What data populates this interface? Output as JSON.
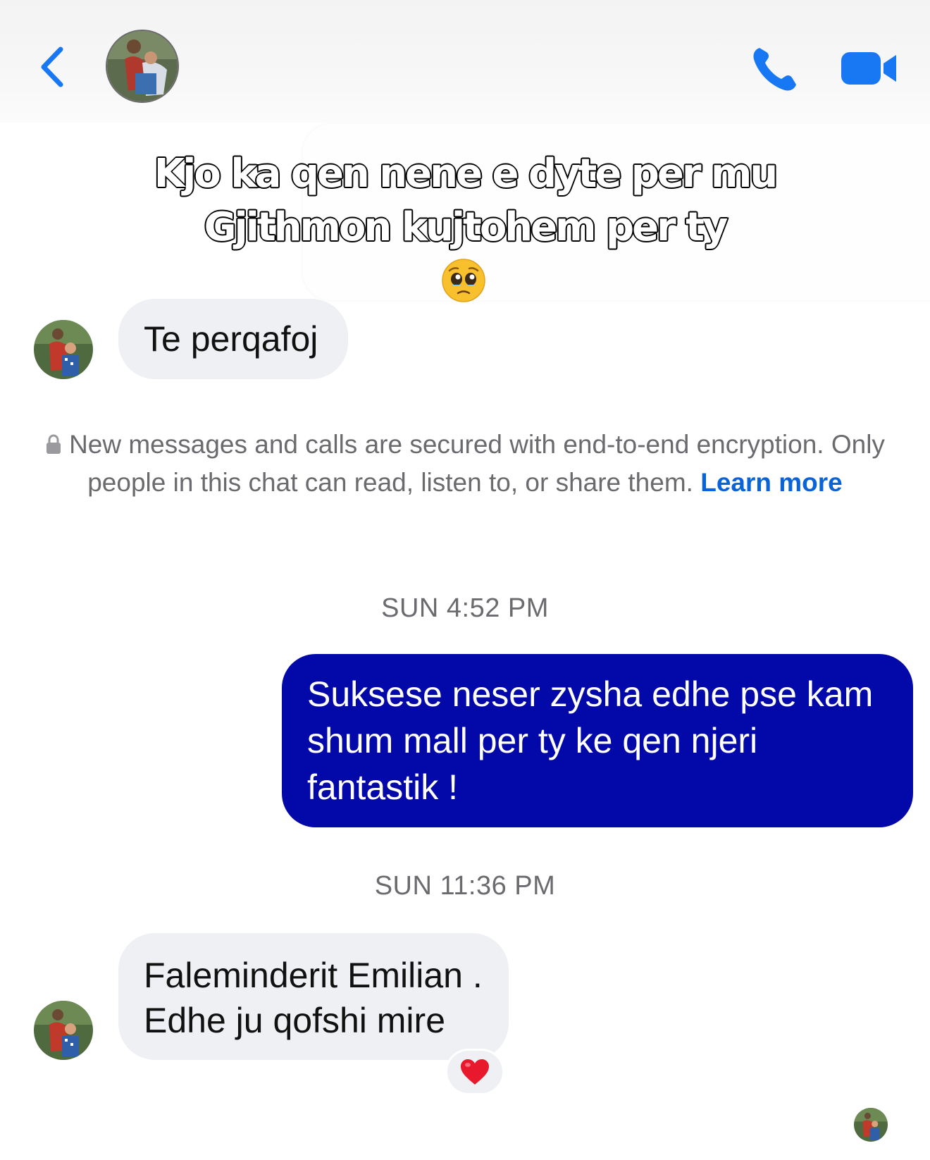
{
  "header": {
    "back_icon": "chevron-left-icon",
    "call_icon": "phone-icon",
    "video_icon": "video-camera-icon",
    "accent_color": "#1877f2"
  },
  "story_reply": {
    "line1": "Kjo ka qen nene e dyte per mu",
    "line2": "Gjithmon kujtohem per ty",
    "emoji": "pleading-face-emoji"
  },
  "messages": {
    "incoming_1": "Te perqafoj",
    "encryption_text": "New messages and calls are secured with end-to-end encryption. Only people in this chat can read, listen to, or share them.",
    "learn_more": "Learn more",
    "timestamp_1": "SUN 4:52 PM",
    "outgoing_1_line1": "Suksese neser zysha edhe pse kam",
    "outgoing_1_line2": "shum mall per ty ke qen njeri",
    "outgoing_1_line3": "fantastik !",
    "timestamp_2": "SUN 11:36 PM",
    "incoming_2_line1": "Faleminderit Emilian .",
    "incoming_2_line2": "Edhe ju qofshi mire",
    "reaction": "heart-emoji"
  },
  "colors": {
    "outgoing_bubble": "#0209a8",
    "incoming_bubble": "#eff0f3",
    "link": "#0b64d7"
  }
}
